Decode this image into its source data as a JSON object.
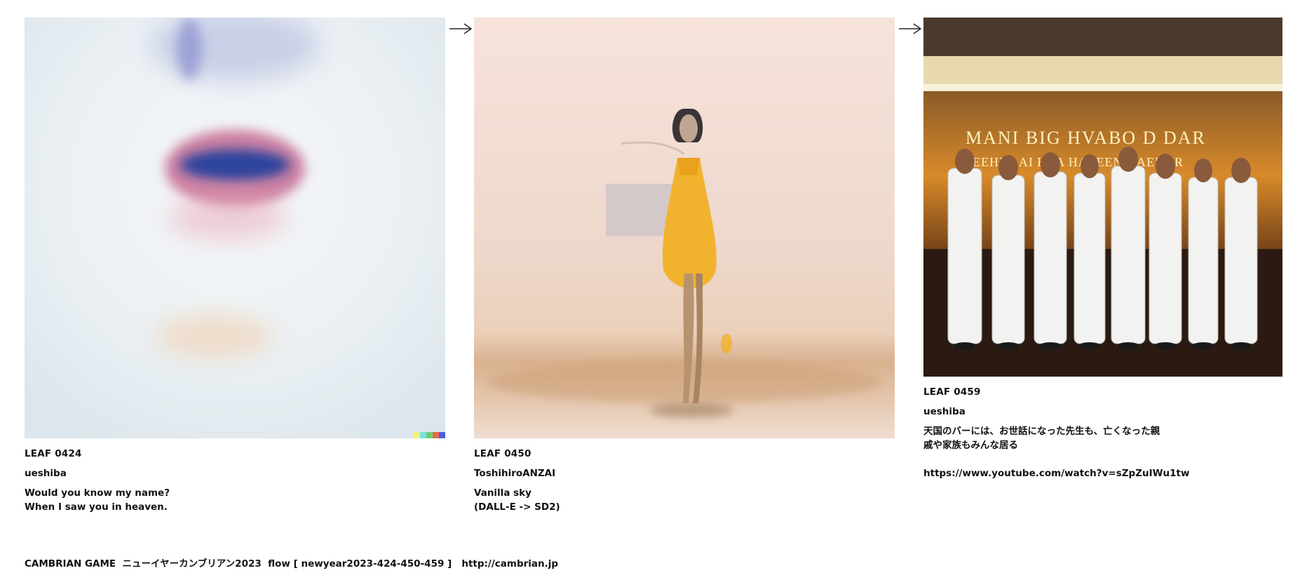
{
  "leaves": [
    {
      "id": "LEAF 0424",
      "user": "ueshiba",
      "caption": "Would you know my name?\nWhen I saw you in heaven.",
      "image_icon": "blurred-face-lips-image"
    },
    {
      "id": "LEAF 0450",
      "user": "ToshihiroANZAI",
      "caption": "Vanilla sky\n(DALL-E -> SD2)",
      "image_icon": "yellow-dress-figure-image"
    },
    {
      "id": "LEAF 0459",
      "user": "ueshiba",
      "caption": "天国のバーには、お世話になった先生も、亡くなった親\n戚や家族もみんな居る",
      "link": "https://www.youtube.com/watch?v=sZpZuIWu1tw",
      "image_icon": "men-in-white-suits-bar-image",
      "sign_text": "MANI BIG HVABO D DAR",
      "sign_text_2": "EEHEL AI HEA HAVEEN HAENOR"
    }
  ],
  "footer": {
    "text": "CAMBRIAN GAME  ニューイヤーカンブリアン2023  flow [ newyear2023-424-450-459 ]   ",
    "link": "http://cambrian.jp"
  },
  "colors": {
    "background": "#ffffff",
    "text": "#111111",
    "leaf1_base": "#eef2f6",
    "leaf2_base": "#f2dccf",
    "leaf3_sign": "#f0a030"
  }
}
